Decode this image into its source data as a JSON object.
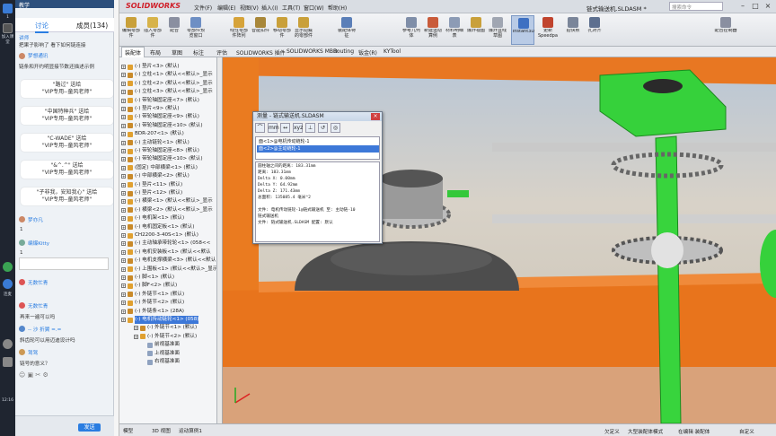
{
  "chat": {
    "window_title": "教学",
    "tabs": [
      "讨论",
      "成员(134)"
    ],
    "intro_lines": [
      "讲师",
      "把果子影响了 看下如何链连接",
      "梦想通讯",
      "链条和开约明显接节数还描述示例"
    ],
    "gift_bubbles": [
      {
        "name": "\"路过\" 送给",
        "target": "\"VIP专用--童风老师\""
      },
      {
        "name": "\"中国特种兵\" 送给",
        "target": "\"VIP专用--童风老师\""
      },
      {
        "name": "\"C-WADE\" 送给",
        "target": "\"VIP专用--童风老师\""
      },
      {
        "name": "\"&^.^\" 送给",
        "target": "\"VIP专用--童风老师\""
      },
      {
        "name": "\"子非我，安知我心\" 送给",
        "target": "\"VIP专用--童风老师\""
      }
    ],
    "users": [
      {
        "name": "梦亦凡",
        "text": "1"
      },
      {
        "name": "编爆Kitty",
        "text": "1"
      },
      {
        "name": "无数忙青",
        "text": ""
      },
      {
        "name": "无数忙青",
        "text": "再来一遍可以吗"
      },
      {
        "name": "-- 沙 折翼 =.=",
        "text": "斜齿轮可以用迈迪设计吗"
      },
      {
        "name": "驾驾",
        "text": "链号的意义？"
      }
    ],
    "send_label": "发送",
    "clock": "12:16"
  },
  "left_strip": [
    "1",
    "加入课堂",
    "连麦"
  ],
  "sw": {
    "app_name": "SOLIDWORKS",
    "menus": [
      "文件(F)",
      "编辑(E)",
      "视图(V)",
      "插入(I)",
      "工具(T)",
      "窗口(W)",
      "帮助(H)"
    ],
    "doc_title": "链式输送机.SLDASM *",
    "search_placeholder": "搜索命令",
    "ribbon": [
      "编辑零部件",
      "插入零部件",
      "配合",
      "零部件预览窗口",
      "线性零部件阵列",
      "智能扣件",
      "移动零部件",
      "显示隐藏的零部件",
      "装配体特征",
      "参考几何体",
      "新建运动算例",
      "材料明细表",
      "爆炸视图",
      "爆炸直线草图",
      "Instant3D",
      "更新Speedpak",
      "拍快照",
      "孔对齐",
      "配合控制器"
    ],
    "cmd_tabs": [
      "装配体",
      "布局",
      "草图",
      "标注",
      "评估",
      "SOLIDWORKS 插件",
      "SOLIDWORKS MBD",
      "Routing",
      "钣金(R)",
      "KYTool"
    ],
    "tree": [
      "(-) 垫片<3> (默认)",
      "(-) 立柱<1> (默认<<默认>_显示",
      "(-) 立柱<2> (默认<<默认>_显示",
      "(-) 立柱<3> (默认<<默认>_显示",
      "(-) 带轮轴固定座<7> (默认)",
      "(-) 垫片<9> (默认)",
      "(-) 带轮轴固定座<9> (默认)",
      "(-) 带轮轴固定座<10> (默认)",
      "BDR-207<1> (默认)",
      "(-) 主动链轮<1> (默认)",
      "(-) 带轮轴固定座<8> (默认)",
      "(-) 带轮轴固定座<10> (默认)",
      "(固定) 中部横梁<1> (默认)",
      "(-) 中部横梁<2> (默认)",
      "(-) 垫片<11> (默认)",
      "(-) 垫片<12> (默认)",
      "(-) 横梁<1> (默认<<默认>_显示",
      "(-) 横梁<2> (默认<<默认>_显示",
      "(-) 电机架<1> (默认)",
      "(-) 电机固定板<1> (默认)",
      "CH2200-3-40S<1> (默认)",
      "(-) 主动轴承带轮轮<1> (058<<",
      "(-) 电机安装板<1> (默认<<默认",
      "(-) 电机支撑横梁<3> (默认<<默认",
      "(-) 上围板<1> (默认<<默认>_显示",
      "(-) 脚<1> (默认)",
      "(-) 脚F<2> (默认)",
      "(-) 外链节<1> (默认)",
      "(-) 外链节<2> (默认)",
      "(-) 外链条<1> (28A)",
      "(-) 电机传动链轮<1> (058)",
      "(-) 外链节<1> (默认)",
      "(-) 外链节<2> (默认)",
      "前视基准面",
      "上视基准面",
      "右视基准面"
    ],
    "tree_selected_index": 30,
    "bottom_tabs": [
      "模型",
      "3D 视图",
      "运动算例1"
    ],
    "status_items": [
      "欠定义",
      "大型装配体模式",
      "在编辑 装配体",
      "自定义"
    ]
  },
  "measure": {
    "title": "测量 - 链式输送机.SLDASM",
    "list": [
      "面<1>@电机传动链轮-1",
      "面<2>@主动链轮-1"
    ],
    "selected": 1,
    "results": [
      "圆柱轴之间的距离:  183.31mm",
      "距离: 183.31mm",
      "Delta X: 0.00mm",
      "Delta Y: 64.92mm",
      "Delta Z: 171.43mm",
      "总面积: 135085.4 毫米^2",
      "",
      "文件: 电机传动链轮-1@链式输送机 至: 主动链-10",
      "链式输送机",
      "文件: 链式输送机.SLDASM 配置: 默认"
    ]
  }
}
